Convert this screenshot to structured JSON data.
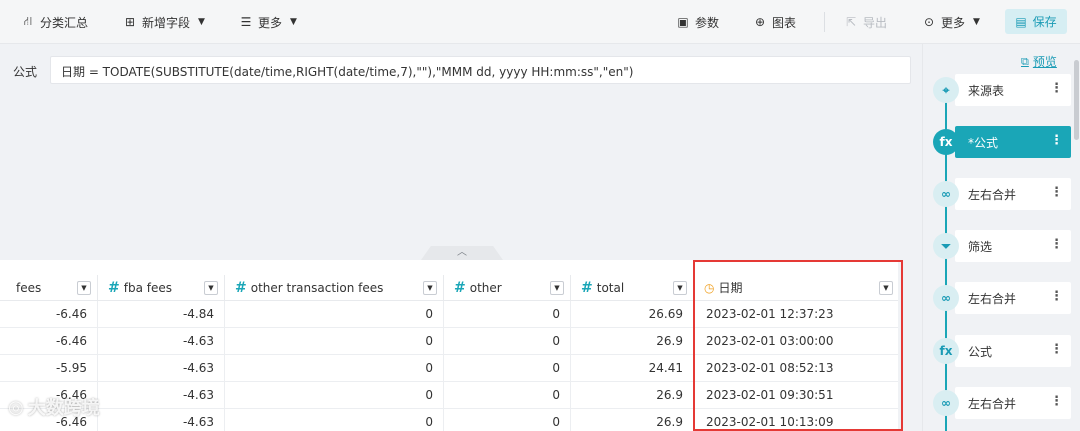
{
  "toolbar": {
    "group_summary": "分类汇总",
    "add_field": "新增字段",
    "more_left": "更多",
    "params": "参数",
    "chart": "图表",
    "export": "导出",
    "more_right": "更多",
    "save": "保存"
  },
  "formula": {
    "label": "公式",
    "expression": "日期 = TODATE(SUBSTITUTE(date/time,RIGHT(date/time,7),\"\"),\"MMM dd, yyyy HH:mm:ss\",\"en\")"
  },
  "table": {
    "columns": [
      {
        "label": "fees",
        "type": "number"
      },
      {
        "label": "fba fees",
        "type": "number"
      },
      {
        "label": "other transaction fees",
        "type": "number"
      },
      {
        "label": "other",
        "type": "number"
      },
      {
        "label": "total",
        "type": "number"
      },
      {
        "label": "日期",
        "type": "datetime"
      }
    ],
    "rows": [
      [
        "-6.46",
        "-4.84",
        "0",
        "0",
        "26.69",
        "2023-02-01 12:37:23"
      ],
      [
        "-6.46",
        "-4.63",
        "0",
        "0",
        "26.9",
        "2023-02-01 03:00:00"
      ],
      [
        "-5.95",
        "-4.63",
        "0",
        "0",
        "24.41",
        "2023-02-01 08:52:13"
      ],
      [
        "-6.46",
        "-4.63",
        "0",
        "0",
        "26.9",
        "2023-02-01 09:30:51"
      ],
      [
        "-6.46",
        "-4.63",
        "0",
        "0",
        "26.9",
        "2023-02-01 10:13:09"
      ]
    ]
  },
  "panel": {
    "preview": "预览",
    "nodes": [
      {
        "label": "来源表",
        "icon": "source-icon",
        "active": false
      },
      {
        "label": "*公式",
        "icon": "formula-icon",
        "active": true
      },
      {
        "label": "左右合并",
        "icon": "merge-icon",
        "active": false
      },
      {
        "label": "筛选",
        "icon": "filter-icon",
        "active": false
      },
      {
        "label": "左右合并",
        "icon": "merge-icon",
        "active": false
      },
      {
        "label": "公式",
        "icon": "formula-icon",
        "active": false
      },
      {
        "label": "左右合并",
        "icon": "merge-icon",
        "active": false
      }
    ]
  },
  "watermark": "大数跨境",
  "colors": {
    "accent": "#1aa6b7",
    "highlight": "#e53935",
    "datetime_icon": "#f0a020"
  }
}
